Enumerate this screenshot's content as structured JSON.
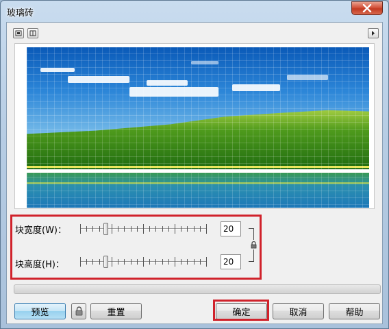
{
  "window": {
    "title": "玻璃砖"
  },
  "toolbar": {
    "left_icons": [
      "preview-split-single-icon",
      "preview-split-dual-icon"
    ],
    "right_icon": "expand-arrow-icon"
  },
  "sliders": [
    {
      "label": "块宽度(W)：",
      "value": "20",
      "level": 0.2
    },
    {
      "label": "块高度(H)：",
      "value": "20",
      "level": 0.2
    }
  ],
  "buttons": {
    "preview": "预览",
    "reset": "重置",
    "ok": "确定",
    "cancel": "取消",
    "help": "帮助"
  },
  "colors": {
    "highlight": "#d0222b",
    "close": "#c23a22"
  }
}
